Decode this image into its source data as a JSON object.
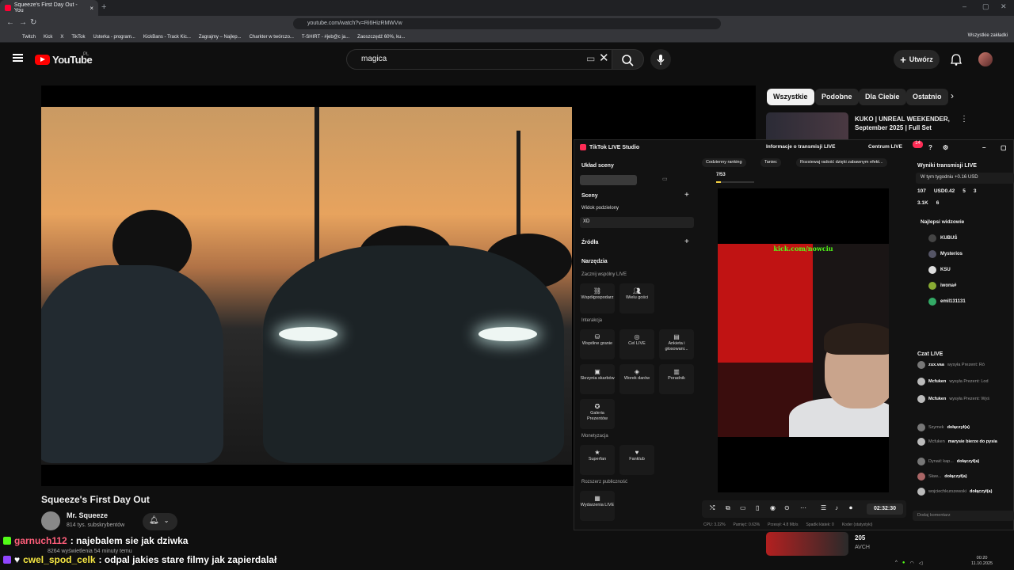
{
  "browser": {
    "tab_title": "Squeeze's First Day Out - You",
    "url": "youtube.com/watch?v=Ri6HizRMWVw",
    "bookmarks": [
      "Twitch",
      "Kick",
      "X",
      "TikTok",
      "Usterka - program...",
      "KickBans - Track Kic...",
      "Zagrajmy – Najlep...",
      "Charkter w twórczo...",
      "T-SHIRT - #jeb@c ja...",
      "Zaoszczędź 60%, ku..."
    ],
    "all_bookmarks": "Wszystkie zakładki"
  },
  "youtube": {
    "logo_text": "YouTube",
    "region": "PL",
    "search_value": "magica",
    "create_label": "Utwórz",
    "chips": [
      "Wszystkie",
      "Podobne",
      "Dla Ciebie",
      "Ostatnio"
    ],
    "video_title": "Squeeze's First Day Out",
    "channel_name": "Mr. Squeeze",
    "subscribers": "814 tys. subskrybentów",
    "views": "8264 wyświetlenia  54 minuty temu",
    "rec1_title": "KUKO | UNREAL WEEKENDER, September 2025 | Full Set",
    "rec2_title": "205",
    "rec2_channel": "AVCH"
  },
  "tiktok": {
    "app_title": "TikTok LIVE Studio",
    "stream_info": "Informacje o transmisji LIVE",
    "centrum": "Centrum LIVE",
    "notif_count": "14",
    "layout_label": "Układ sceny",
    "scenes_label": "Sceny",
    "split_view": "Widok podzielony",
    "scene_item": "XD",
    "sources_label": "Źródła",
    "tools_label": "Narzędzia",
    "co_live_label": "Zacznij wspólny LIVE",
    "tools_co": [
      "Współgospodarz",
      "Wielu gości"
    ],
    "interaction_label": "Interakcja",
    "tools_interaction": [
      "Wspólne granie",
      "Cel LIVE",
      "Ankieta i głosowani...",
      "Skrzynia skarbów",
      "Worek darów",
      "Poradnik",
      "Galeria Prezentów"
    ],
    "monetization_label": "Monetyzacja",
    "tools_monetization": [
      "Superfan",
      "Fanklub"
    ],
    "audience_label": "Rozszerz publiczność",
    "tools_audience": [
      "Wydarzenia LIVE"
    ],
    "pills": [
      "Codzienny ranking",
      "Taniec",
      "Rozsiewaj radość dzięki zabawnym efekt..."
    ],
    "goal_count": "7/53",
    "overlay_text": "kick.com/nowciu",
    "timer": "02:32:30",
    "stats": [
      "CPU: 3.22%",
      "Pamięć: 0.63%",
      "Przesył: 4.8 Mb/s",
      "Spadki klatek: 0",
      "Koder (statystyki)"
    ],
    "results_label": "Wyniki transmisji LIVE",
    "week_label": "W tym tygodniu +0.16 USD",
    "stat_row1": [
      "107",
      "USD0.42",
      "5",
      "3"
    ],
    "stat_row2": [
      "3.1K",
      "6"
    ],
    "top_viewers_label": "Najlepsi widzowie",
    "viewers": [
      "KUBUŚ",
      "Mysterios",
      "KSU",
      "iwona#",
      "emil131131"
    ],
    "chat_label": "Czat LIVE",
    "chat": [
      {
        "user": "zux.vaa",
        "text": "wysyła Prezent: Ró"
      },
      {
        "user": "Mcfuken",
        "text": "wysyła Prezent: Lod"
      },
      {
        "user": "Mcfuken",
        "text": "wysyła Prezent: Wyś"
      },
      {
        "user": "Szymek",
        "text": "dołączył(a)"
      },
      {
        "user": "Mcfuken",
        "text": "marysie bierze do pysia"
      },
      {
        "user": "Dynaić kap...",
        "text": "dołączył(a)"
      },
      {
        "user": "Sław...",
        "text": "dołączył(a)"
      },
      {
        "user": "wojciechkurszewski",
        "text": "dołączył(a)"
      }
    ],
    "comment_placeholder": "Dodaj komentarz"
  },
  "overlay_chat": [
    {
      "user": "garnuch112",
      "text": ": najebalem sie jak dziwka"
    },
    {
      "user": "cwel_spod_celk",
      "text": ": odpal jakies stare filmy jak zapierdalał"
    }
  ],
  "system": {
    "time": "00:20",
    "date": "11.10.2025"
  }
}
